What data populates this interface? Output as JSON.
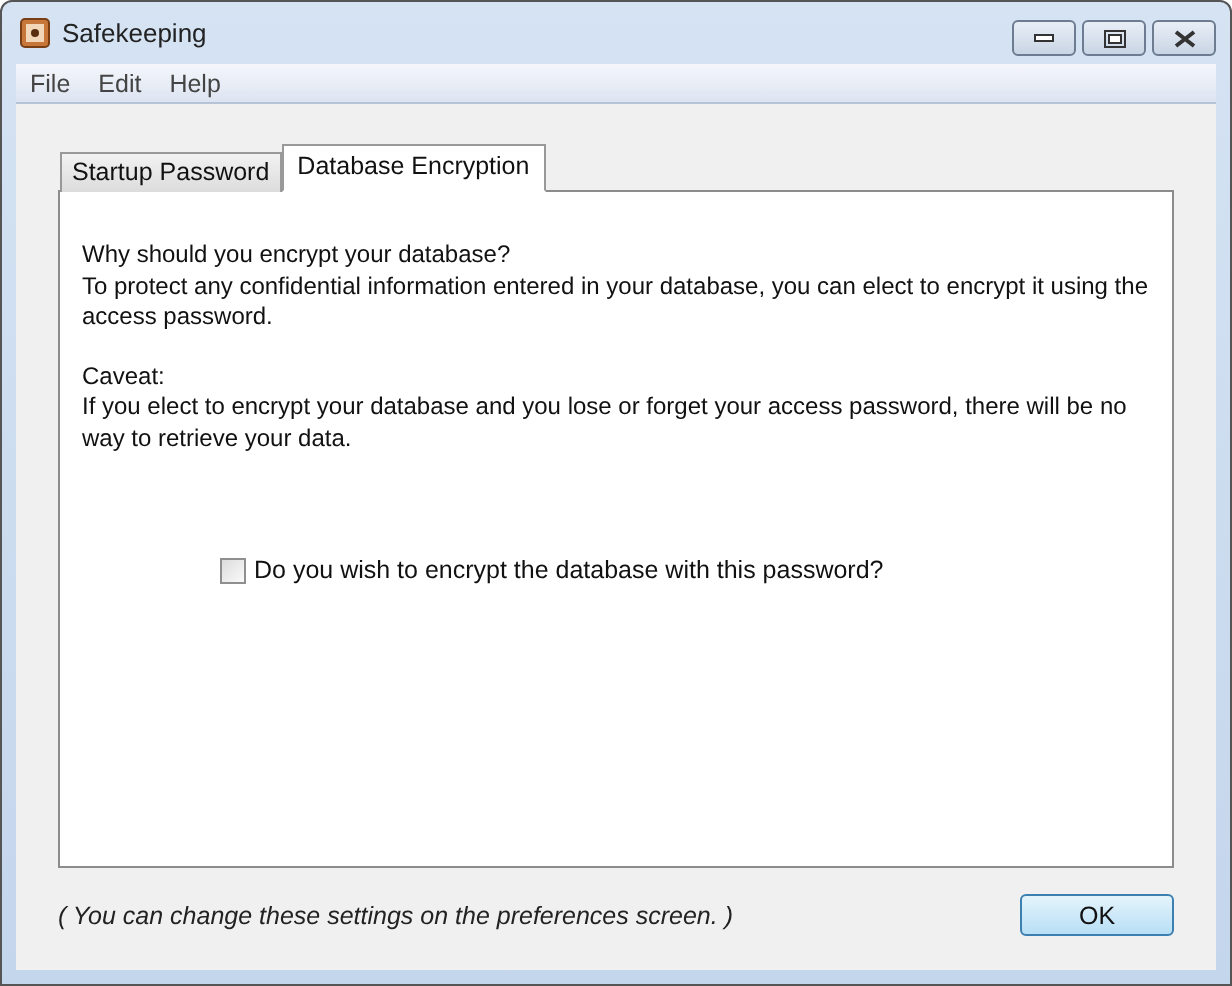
{
  "window": {
    "title": "Safekeeping"
  },
  "menu": [
    "File",
    "Edit",
    "Help"
  ],
  "tabs": [
    {
      "label": "Startup Password",
      "selected": false
    },
    {
      "label": "Database Encryption",
      "selected": true
    }
  ],
  "panel": {
    "paragraphs": [
      {
        "heading": "Why should you encrypt your database?",
        "body": "To protect any confidential information entered in your database, you can elect to encrypt it using the access password."
      },
      {
        "heading": "Caveat:",
        "body": "If you elect to encrypt your database and you lose or forget your access password, there will be no way to retrieve your data."
      }
    ],
    "checkbox": {
      "label": "Do you wish to encrypt the database with this password?",
      "checked": false
    }
  },
  "footer_note": "( You can change these settings on the preferences screen. )",
  "buttons": [
    "OK"
  ]
}
